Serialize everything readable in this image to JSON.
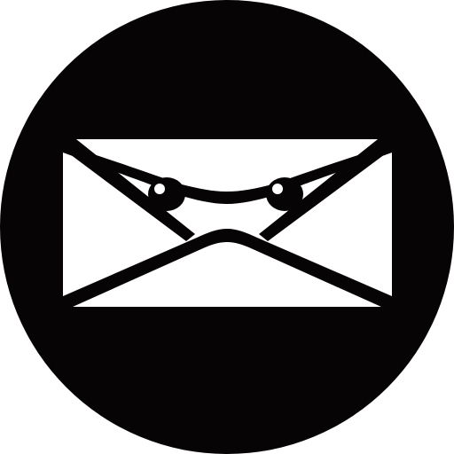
{
  "icon": {
    "name": "ninja-mail-icon",
    "colors": {
      "background": "#ffffff",
      "circle": "#070405",
      "envelope": "#ffffff",
      "lines": "#070405"
    }
  }
}
